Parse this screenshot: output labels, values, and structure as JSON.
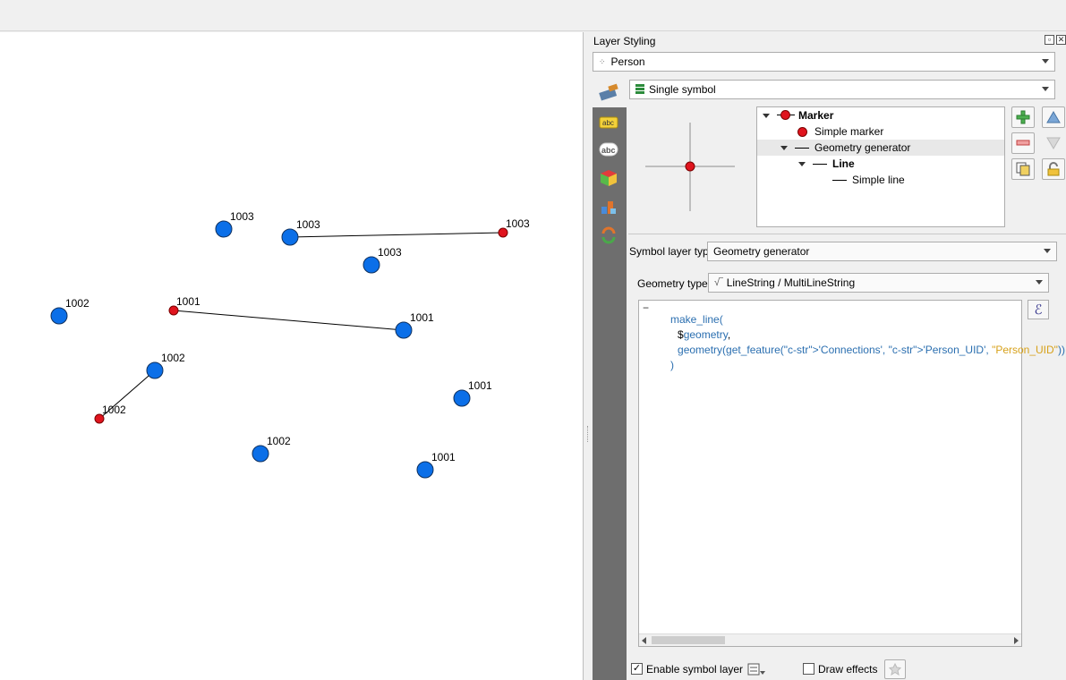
{
  "panel": {
    "title": "Layer Styling",
    "layer_combo": "Person",
    "renderer_combo": "Single symbol",
    "symbol_tree": [
      {
        "label": "Marker",
        "kind": "marker",
        "bold": true
      },
      {
        "label": "Simple marker",
        "kind": "simple-marker",
        "bold": false
      },
      {
        "label": "Geometry generator",
        "kind": "generator",
        "bold": false,
        "selected": true
      },
      {
        "label": "Line",
        "kind": "line",
        "bold": true
      },
      {
        "label": "Simple line",
        "kind": "simple-line",
        "bold": false
      }
    ],
    "symbol_layer_type_label": "Symbol layer type",
    "symbol_layer_type_value": "Geometry generator",
    "geometry_type_label": "Geometry type",
    "geometry_type_value": "LineString / MultiLineString",
    "expression_lines": [
      "make_line(",
      "$geometry,",
      "geometry(get_feature('Connections', 'Person_UID', \"Person_UID\"))",
      ")"
    ],
    "enable_symbol_layer_label": "Enable symbol layer",
    "enable_symbol_layer_checked": true,
    "draw_effects_label": "Draw effects",
    "draw_effects_checked": false,
    "epsilon_glyph": "ℰ"
  },
  "map": {
    "point_colors": {
      "blue": "#0b6fe8",
      "red": "#e0141e"
    },
    "features": [
      {
        "label": "1003",
        "kind": "blue"
      },
      {
        "label": "1003",
        "kind": "blue"
      },
      {
        "label": "1003",
        "kind": "red"
      },
      {
        "label": "1003",
        "kind": "blue"
      },
      {
        "label": "1002",
        "kind": "blue"
      },
      {
        "label": "1001",
        "kind": "red"
      },
      {
        "label": "1001",
        "kind": "blue"
      },
      {
        "label": "1002",
        "kind": "blue"
      },
      {
        "label": "1001",
        "kind": "blue"
      },
      {
        "label": "1002",
        "kind": "red"
      },
      {
        "label": "1002",
        "kind": "blue"
      },
      {
        "label": "1001",
        "kind": "blue"
      }
    ],
    "connections": [
      [
        1,
        2
      ],
      [
        5,
        6
      ],
      [
        7,
        9
      ]
    ]
  }
}
